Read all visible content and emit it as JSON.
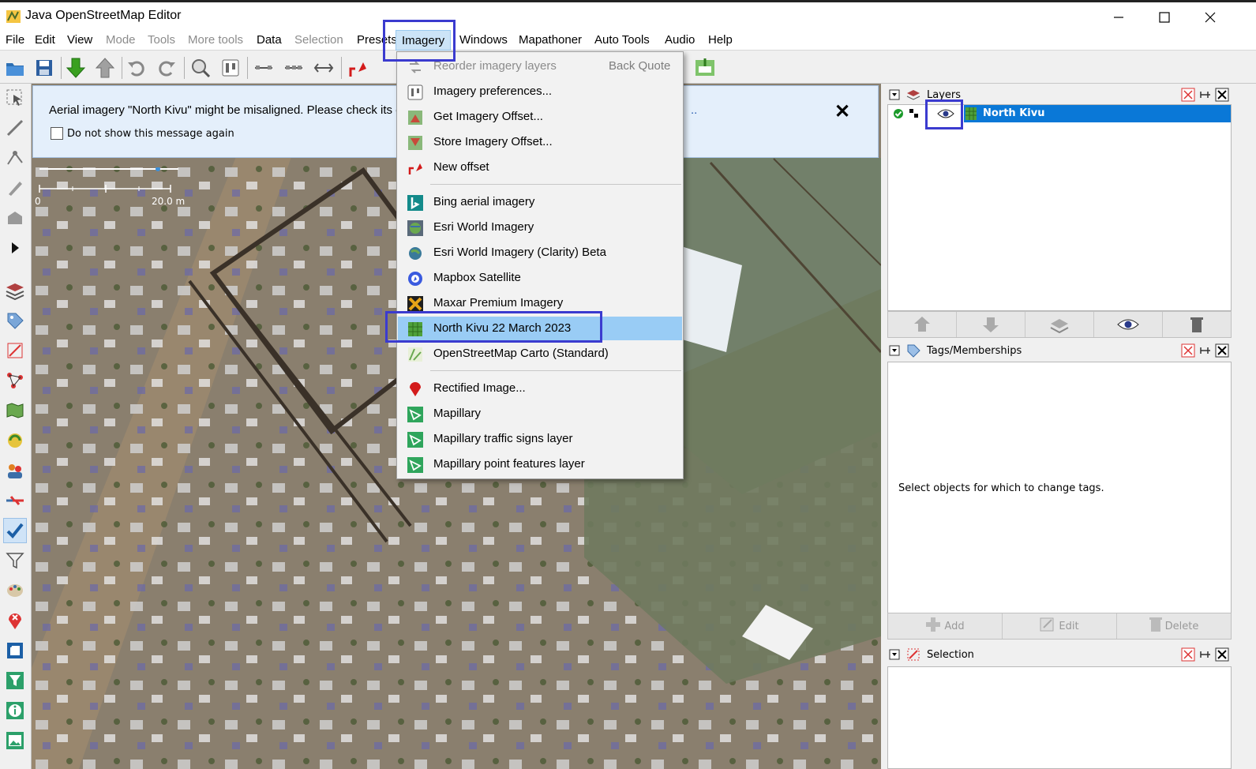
{
  "window": {
    "title": "Java OpenStreetMap Editor",
    "controls": [
      "minimize",
      "maximize",
      "close"
    ]
  },
  "menubar": {
    "items": [
      {
        "label": "File",
        "enabled": true
      },
      {
        "label": "Edit",
        "enabled": true
      },
      {
        "label": "View",
        "enabled": true
      },
      {
        "label": "Mode",
        "enabled": false
      },
      {
        "label": "Tools",
        "enabled": false
      },
      {
        "label": "More tools",
        "enabled": false
      },
      {
        "label": "Data",
        "enabled": true
      },
      {
        "label": "Selection",
        "enabled": false
      },
      {
        "label": "Presets",
        "enabled": true
      },
      {
        "label": "Imagery",
        "enabled": true,
        "active": true
      },
      {
        "label": "Windows",
        "enabled": true
      },
      {
        "label": "Mapathoner",
        "enabled": true
      },
      {
        "label": "Auto Tools",
        "enabled": true
      },
      {
        "label": "Audio",
        "enabled": true
      },
      {
        "label": "Help",
        "enabled": true
      }
    ]
  },
  "imagery_menu": {
    "items": [
      {
        "label": "Reorder imagery layers",
        "accelerator": "Back Quote",
        "enabled": false,
        "icon": "reorder-icon"
      },
      {
        "label": "Imagery preferences...",
        "icon": "preferences-icon"
      },
      {
        "label": "Get Imagery Offset...",
        "icon": "get-offset-icon"
      },
      {
        "label": "Store Imagery Offset...",
        "icon": "store-offset-icon"
      },
      {
        "label": "New offset",
        "icon": "new-offset-icon"
      },
      {
        "label": "Bing aerial imagery",
        "icon": "bing-icon"
      },
      {
        "label": "Esri World Imagery",
        "icon": "esri-globe-icon"
      },
      {
        "label": "Esri World Imagery (Clarity) Beta",
        "icon": "esri-clarity-icon"
      },
      {
        "label": "Mapbox Satellite",
        "icon": "mapbox-icon"
      },
      {
        "label": "Maxar Premium Imagery",
        "icon": "maxar-icon"
      },
      {
        "label": "North Kivu 22 March 2023",
        "icon": "grid-tiles-icon",
        "highlighted": true
      },
      {
        "label": "OpenStreetMap Carto (Standard)",
        "icon": "osm-icon"
      },
      {
        "label": "Rectified Image...",
        "icon": "rectified-marker-icon"
      },
      {
        "label": "Mapillary",
        "icon": "mapillary-icon"
      },
      {
        "label": "Mapillary traffic signs layer",
        "icon": "mapillary-icon"
      },
      {
        "label": "Mapillary point features layer",
        "icon": "mapillary-icon"
      }
    ]
  },
  "notice": {
    "message": "Aerial imagery \"North Kivu\" might be misaligned. Please check its offs",
    "checkbox_label": "Do not show this message again",
    "checkbox_checked": false,
    "close_symbol": "✕"
  },
  "scale": {
    "start": "0",
    "end": "20.0 m"
  },
  "layers_panel": {
    "title": "Layers",
    "layers": [
      {
        "name": "North Kivu",
        "visible": true,
        "active": true,
        "selected": true
      }
    ]
  },
  "tags_panel": {
    "title": "Tags/Memberships",
    "empty_message": "Select objects for which to change tags.",
    "buttons": {
      "add": "Add",
      "edit": "Edit",
      "delete": "Delete"
    }
  },
  "selection_panel": {
    "title": "Selection"
  },
  "colors": {
    "menu_highlight": "#99ccf5",
    "layer_selected": "#0a78d7",
    "annotation": "#3b3bcf",
    "notice_bg": "#e4effb"
  }
}
